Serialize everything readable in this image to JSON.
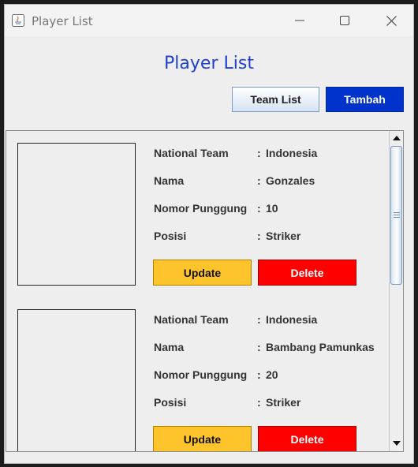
{
  "window": {
    "title": "Player List"
  },
  "header": {
    "title": "Player List"
  },
  "toolbar": {
    "team_list_label": "Team List",
    "tambah_label": "Tambah"
  },
  "players": [
    {
      "fields": [
        {
          "label": "National Team",
          "value": "Indonesia"
        },
        {
          "label": "Nama",
          "value": "Gonzales"
        },
        {
          "label": "Nomor Punggung",
          "value": "10"
        },
        {
          "label": "Posisi",
          "value": "Striker"
        }
      ],
      "update_label": "Update",
      "delete_label": "Delete"
    },
    {
      "fields": [
        {
          "label": "National Team",
          "value": "Indonesia"
        },
        {
          "label": "Nama",
          "value": "Bambang Pamunkas"
        },
        {
          "label": "Nomor Punggung",
          "value": "20"
        },
        {
          "label": "Posisi",
          "value": "Striker"
        }
      ],
      "update_label": "Update",
      "delete_label": "Delete"
    }
  ],
  "colon": ":",
  "colors": {
    "heading": "#1f3fd0",
    "tambah": "#0033cc",
    "update": "#ffc42c",
    "delete": "#ff0000"
  },
  "icons": [
    "java-icon",
    "minimize-icon",
    "maximize-icon",
    "close-icon",
    "scroll-up-arrow-icon",
    "scroll-down-arrow-icon",
    "scroll-grip-icon"
  ]
}
